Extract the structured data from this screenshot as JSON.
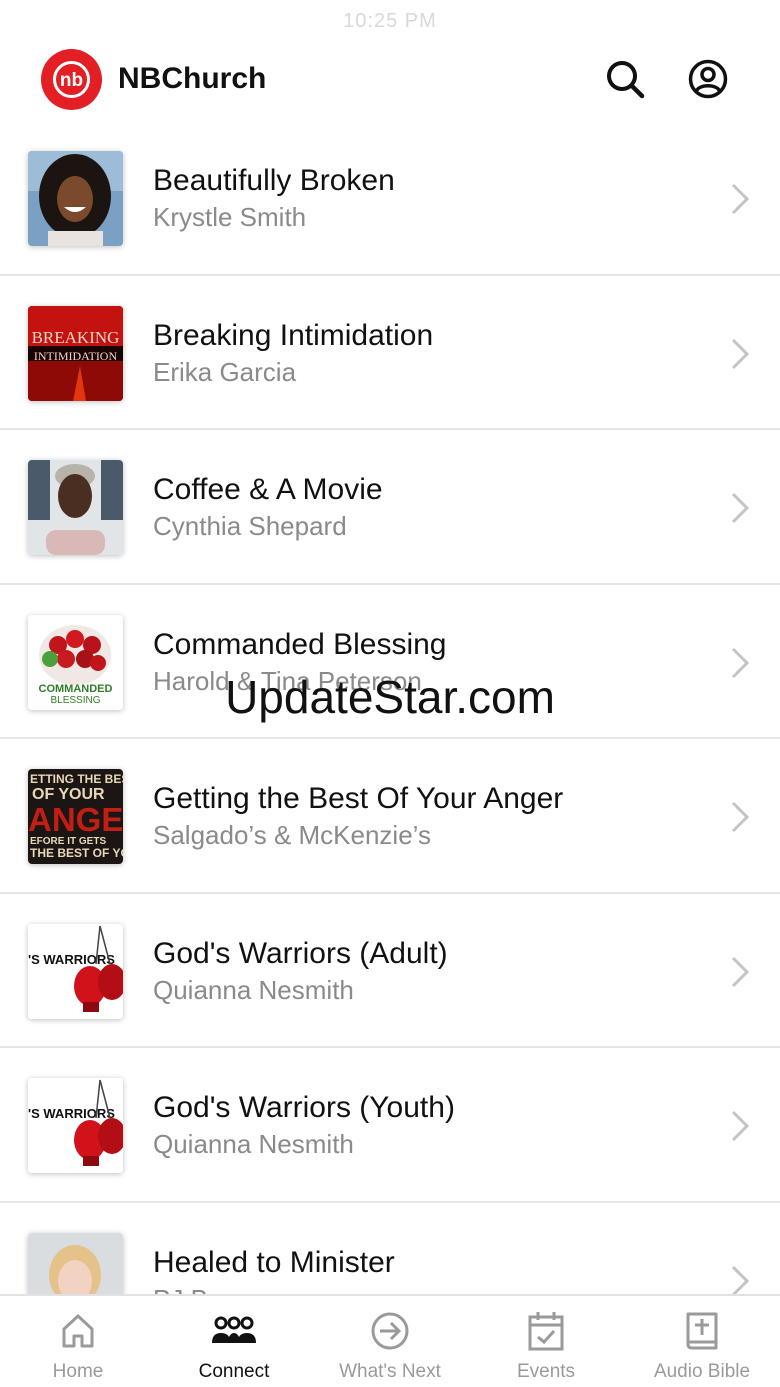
{
  "status_bar": {
    "time": "10:25 PM"
  },
  "header": {
    "brand": "NBChurch",
    "logo_text": "nb"
  },
  "groups": [
    {
      "title": "Beautifully Broken",
      "subtitle": "Krystle Smith"
    },
    {
      "title": "Breaking Intimidation",
      "subtitle": "Erika Garcia",
      "thumb_text_1": "BREAKING",
      "thumb_text_2": "INTIMIDATION"
    },
    {
      "title": "Coffee & A Movie",
      "subtitle": "Cynthia Shepard"
    },
    {
      "title": "Commanded Blessing",
      "subtitle": "Harold & Tina Peterson",
      "thumb_text_1": "COMMANDED",
      "thumb_text_2": "BLESSING"
    },
    {
      "title": "Getting the Best Of Your Anger",
      "subtitle": "Salgado’s & McKenzie’s",
      "thumb_text_1": "ETTING THE BEST",
      "thumb_text_2": "OF YOUR",
      "thumb_text_3": "ANGER",
      "thumb_text_4": "EFORE IT GETS",
      "thumb_text_5": "THE BEST OF YO"
    },
    {
      "title": "God's Warriors (Adult)",
      "subtitle": "Quianna Nesmith",
      "thumb_text_1": "'S WARRIORS"
    },
    {
      "title": "God's Warriors (Youth)",
      "subtitle": "Quianna Nesmith",
      "thumb_text_1": "'S WARRIORS"
    },
    {
      "title": "Healed to Minister",
      "subtitle": "PJ Broome"
    }
  ],
  "watermark": "UpdateStar.com",
  "tabbar": [
    {
      "label": "Home",
      "icon": "home-icon",
      "active": false
    },
    {
      "label": "Connect",
      "icon": "people-icon",
      "active": true
    },
    {
      "label": "What's Next",
      "icon": "arrow-circle-icon",
      "active": false
    },
    {
      "label": "Events",
      "icon": "calendar-check-icon",
      "active": false
    },
    {
      "label": "Audio Bible",
      "icon": "bible-icon",
      "active": false
    }
  ],
  "colors": {
    "brand_red": "#e31e24",
    "subtitle_gray": "#8a8a8a",
    "tab_inactive": "#9a9a9a",
    "tab_active": "#111111"
  }
}
